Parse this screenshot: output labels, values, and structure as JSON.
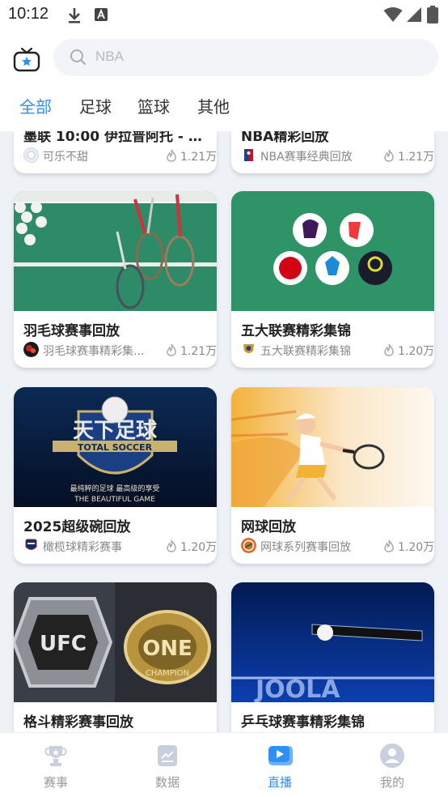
{
  "status": {
    "time": "10:12"
  },
  "search": {
    "placeholder": "NBA"
  },
  "tabs": [
    {
      "label": "全部",
      "active": true
    },
    {
      "label": "足球",
      "active": false
    },
    {
      "label": "篮球",
      "active": false
    },
    {
      "label": "其他",
      "active": false
    }
  ],
  "cards": [
    {
      "title": "墨联 10:00 伊拉普阿托 - 阿...",
      "channel": "可乐不甜",
      "views": "1.21万",
      "avatar_icon": "cola-avatar-icon",
      "thumb": "none"
    },
    {
      "title": "NBA精彩回放",
      "channel": "NBA赛事经典回放",
      "views": "1.21万",
      "avatar_icon": "nba-logo-icon",
      "thumb": "none"
    },
    {
      "title": "羽毛球赛事回放",
      "channel": "羽毛球赛事精彩集...",
      "views": "1.21万",
      "avatar_icon": "badminton-avatar-icon",
      "thumb": "badminton-court-image"
    },
    {
      "title": "五大联赛精彩集锦",
      "channel": "五大联赛精彩集锦",
      "views": "1.20万",
      "avatar_icon": "league-crest-icon",
      "thumb": "football-leagues-logos-image"
    },
    {
      "title": "2025超级碗回放",
      "channel": "橄榄球精彩赛事",
      "views": "1.20万",
      "avatar_icon": "nfl-logo-icon",
      "thumb": "total-soccer-logo-image"
    },
    {
      "title": "网球回放",
      "channel": "网球系列赛事回放",
      "views": "1.20万",
      "avatar_icon": "tennis-avatar-icon",
      "thumb": "tennis-player-illustration"
    },
    {
      "title": "格斗精彩赛事回放",
      "channel": "",
      "views": "",
      "avatar_icon": "",
      "thumb": "championship-belts-image"
    },
    {
      "title": "乒乓球赛事精彩集锦",
      "channel": "",
      "views": "",
      "avatar_icon": "",
      "thumb": "table-tennis-image"
    }
  ],
  "thumb_text": {
    "total_soccer_cn": "天下足球",
    "total_soccer_en": "TOTAL SOCCER",
    "total_soccer_slogan_en": "THE BEAUTIFUL GAME",
    "total_soccer_slogan_cn": "最纯粹的足球 最高级的享受",
    "ufc": "UFC",
    "one": "ONE",
    "champion": "CHAMPION",
    "joola": "JOOLA"
  },
  "bottom_nav": [
    {
      "label": "赛事",
      "icon": "trophy-icon",
      "active": false
    },
    {
      "label": "数据",
      "icon": "data-icon",
      "active": false
    },
    {
      "label": "直播",
      "icon": "play-icon",
      "active": true
    },
    {
      "label": "我的",
      "icon": "profile-icon",
      "active": false
    }
  ],
  "colors": {
    "accent": "#2e8ff5",
    "background": "#eef1f6"
  }
}
